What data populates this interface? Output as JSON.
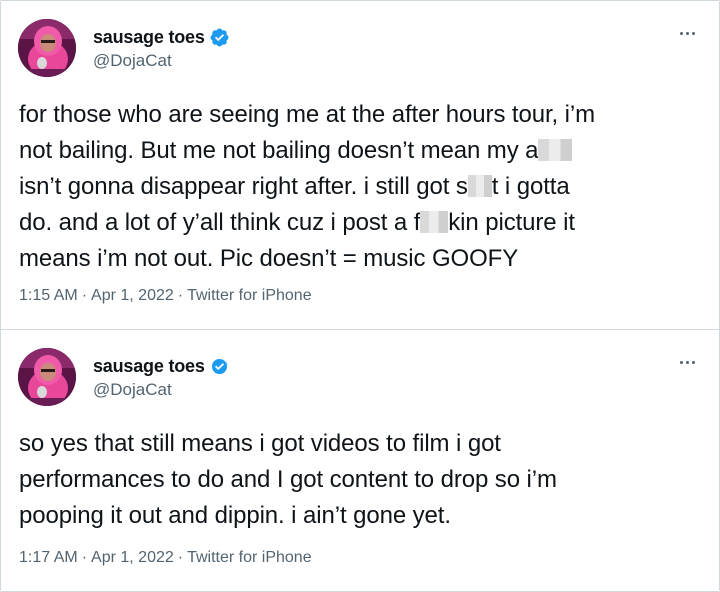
{
  "tweets": [
    {
      "display_name": "sausage toes",
      "handle": "@DojaCat",
      "verified_icon": "verified-badge-icon",
      "text_parts": {
        "l1": "for those who are seeing me at the after hours tour, i’m",
        "l2a": "not bailing. But me not bailing doesn’t mean my a",
        "l3a": "isn’t gonna disappear right after. i still got s",
        "l3b": "t i gotta",
        "l4a": "do. and a lot of y’all think cuz i post a f",
        "l4b": "kin picture it",
        "l5": "means i’m not out. Pic doesn’t = music GOOFY"
      },
      "time": "1:15 AM",
      "date": "Apr 1, 2022",
      "source": "Twitter for iPhone",
      "separator": "·"
    },
    {
      "display_name": "sausage toes",
      "handle": "@DojaCat",
      "verified_icon": "verified-badge-icon",
      "text_lines": [
        "so yes that still means i got videos to film i got",
        "performances to do and I got content to drop so i’m",
        "pooping it out and dippin. i ain’t gone yet."
      ],
      "time": "1:17 AM",
      "date": "Apr 1, 2022",
      "source": "Twitter for iPhone",
      "separator": "·"
    }
  ],
  "colors": {
    "text": "#0f1419",
    "secondary": "#536471",
    "verified": "#1d9bf0",
    "border": "#cfd9de"
  }
}
